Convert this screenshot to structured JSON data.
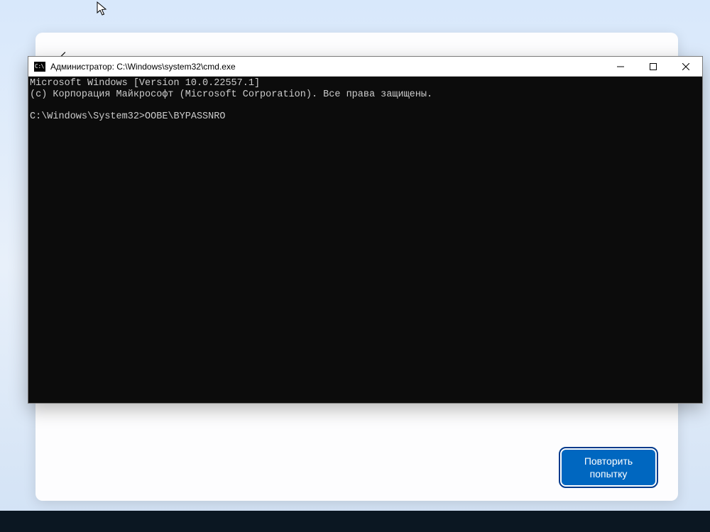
{
  "cmd": {
    "title": "Администратор: C:\\Windows\\system32\\cmd.exe",
    "line1": "Microsoft Windows [Version 10.0.22557.1]",
    "line2": "(c) Корпорация Майкрософт (Microsoft Corporation). Все права защищены.",
    "prompt": "C:\\Windows\\System32>",
    "command": "OOBE\\BYPASSNRO"
  },
  "oobe": {
    "retry_label": "Повторить попытку"
  }
}
